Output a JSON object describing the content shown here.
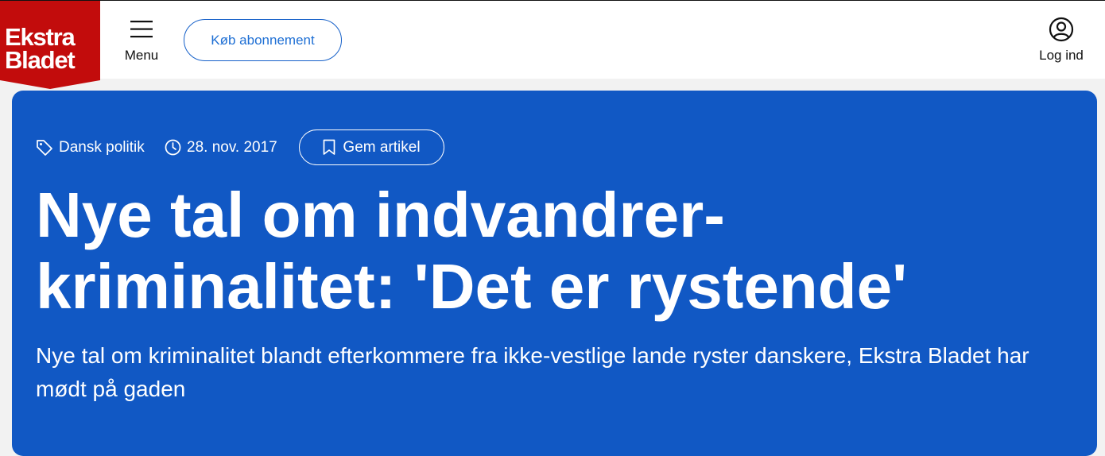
{
  "header": {
    "logo_line1": "Ekstra",
    "logo_line2": "Bladet",
    "brand_color": "#c20c0c",
    "menu_label": "Menu",
    "subscribe_label": "Køb abonnement",
    "login_label": "Log ind"
  },
  "article": {
    "category": "Dansk politik",
    "date": "28. nov. 2017",
    "save_label": "Gem artikel",
    "headline_line1": "Nye tal om indvandrer-",
    "headline_line2": "kriminalitet: 'Det er rystende'",
    "subheadline": "Nye tal om kriminalitet blandt efterkommere fra ikke-vestlige lande ryster danskere, Ekstra Bladet har mødt på gaden",
    "hero_color": "#1158c4"
  },
  "icons": {
    "menu": "hamburger-icon",
    "login": "user-circle-icon",
    "category": "tag-icon",
    "date": "clock-icon",
    "save": "bookmark-icon"
  }
}
